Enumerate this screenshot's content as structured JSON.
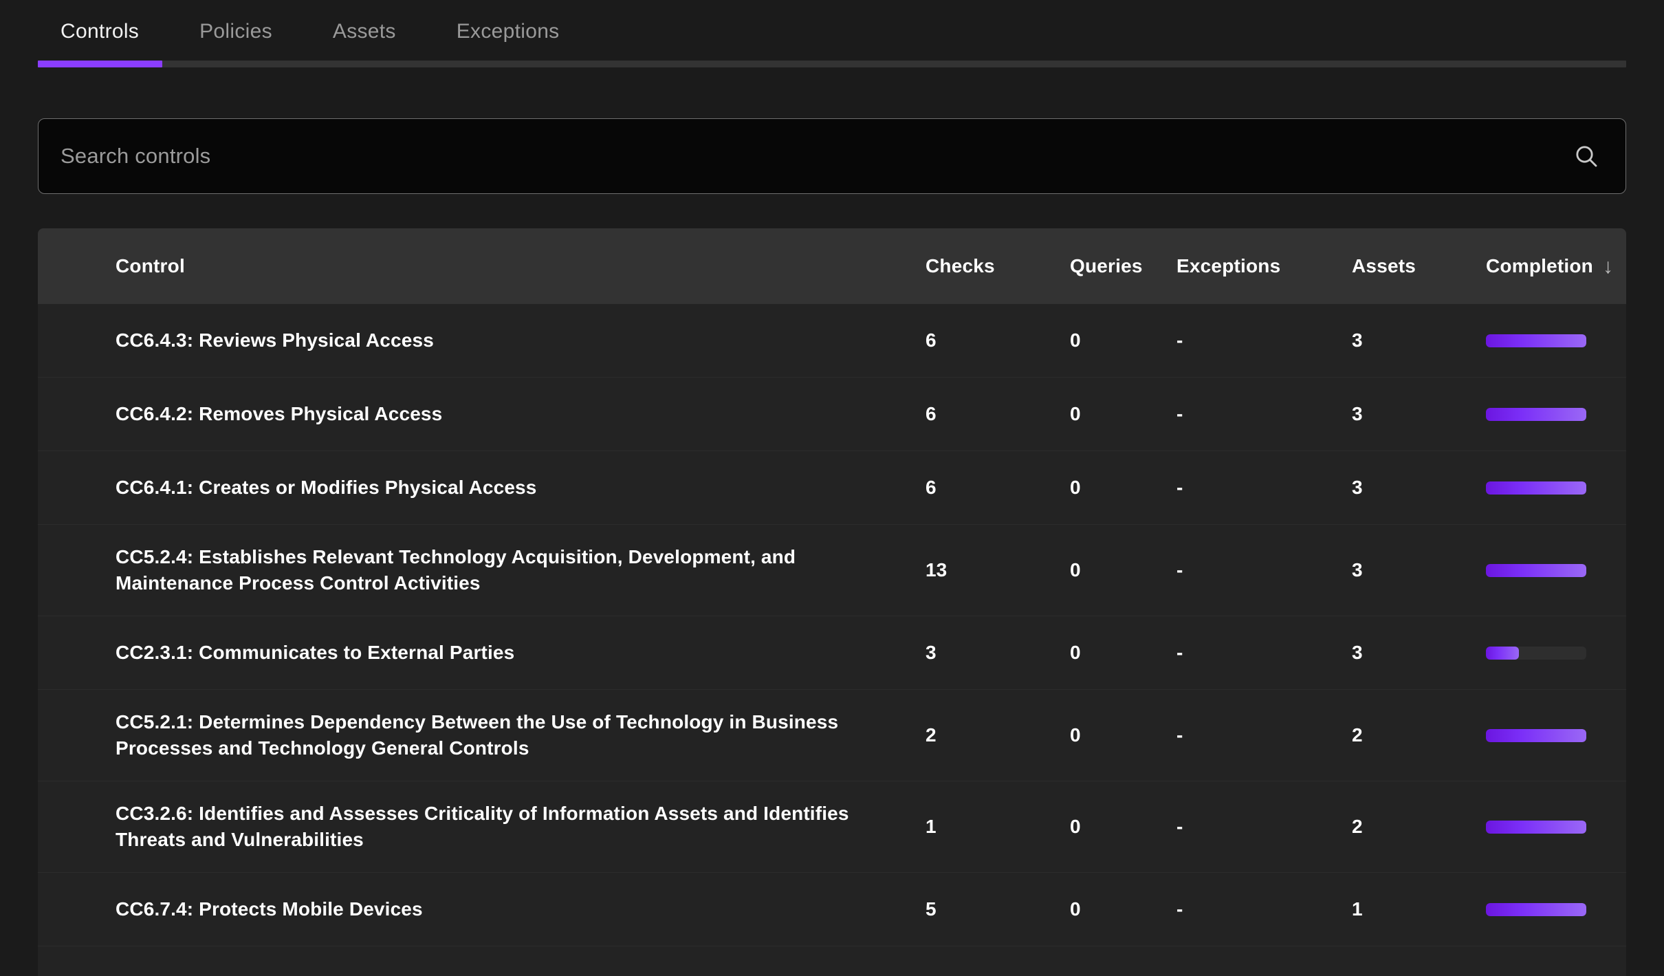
{
  "tabs": [
    {
      "label": "Controls",
      "active": true
    },
    {
      "label": "Policies",
      "active": false
    },
    {
      "label": "Assets",
      "active": false
    },
    {
      "label": "Exceptions",
      "active": false
    }
  ],
  "search": {
    "placeholder": "Search controls",
    "value": "",
    "icon": "search-icon"
  },
  "table": {
    "columns": [
      {
        "key": "control",
        "label": "Control"
      },
      {
        "key": "checks",
        "label": "Checks"
      },
      {
        "key": "queries",
        "label": "Queries"
      },
      {
        "key": "exceptions",
        "label": "Exceptions"
      },
      {
        "key": "assets",
        "label": "Assets"
      },
      {
        "key": "completion",
        "label": "Completion"
      }
    ],
    "sort": {
      "column": "Completion",
      "direction": "desc",
      "arrow": "↓"
    },
    "rows": [
      {
        "control": "CC6.4.3: Reviews Physical Access",
        "checks": "6",
        "queries": "0",
        "exceptions": "-",
        "assets": "3",
        "completion": 100,
        "tall": false
      },
      {
        "control": "CC6.4.2: Removes Physical Access",
        "checks": "6",
        "queries": "0",
        "exceptions": "-",
        "assets": "3",
        "completion": 100,
        "tall": false
      },
      {
        "control": "CC6.4.1: Creates or Modifies Physical Access",
        "checks": "6",
        "queries": "0",
        "exceptions": "-",
        "assets": "3",
        "completion": 100,
        "tall": false
      },
      {
        "control": "CC5.2.4: Establishes Relevant Technology Acquisition, Development, and Maintenance Process Control Activities",
        "checks": "13",
        "queries": "0",
        "exceptions": "-",
        "assets": "3",
        "completion": 100,
        "tall": true
      },
      {
        "control": "CC2.3.1: Communicates to External Parties",
        "checks": "3",
        "queries": "0",
        "exceptions": "-",
        "assets": "3",
        "completion": 33,
        "tall": false
      },
      {
        "control": "CC5.2.1: Determines Dependency Between the Use of Technology in Business Processes and Technology General Controls",
        "checks": "2",
        "queries": "0",
        "exceptions": "-",
        "assets": "2",
        "completion": 100,
        "tall": true
      },
      {
        "control": "CC3.2.6: Identifies and Assesses Criticality of Information Assets and Identifies Threats and Vulnerabilities",
        "checks": "1",
        "queries": "0",
        "exceptions": "-",
        "assets": "2",
        "completion": 100,
        "tall": true
      },
      {
        "control": "CC6.7.4: Protects Mobile Devices",
        "checks": "5",
        "queries": "0",
        "exceptions": "-",
        "assets": "1",
        "completion": 100,
        "tall": false
      }
    ]
  },
  "colors": {
    "accent": "#8b3dff",
    "bar_gradient_start": "#6b16e0",
    "bar_gradient_end": "#9a68f6",
    "page_background": "#1b1b1b",
    "table_background": "#232323",
    "header_background": "#333333"
  }
}
